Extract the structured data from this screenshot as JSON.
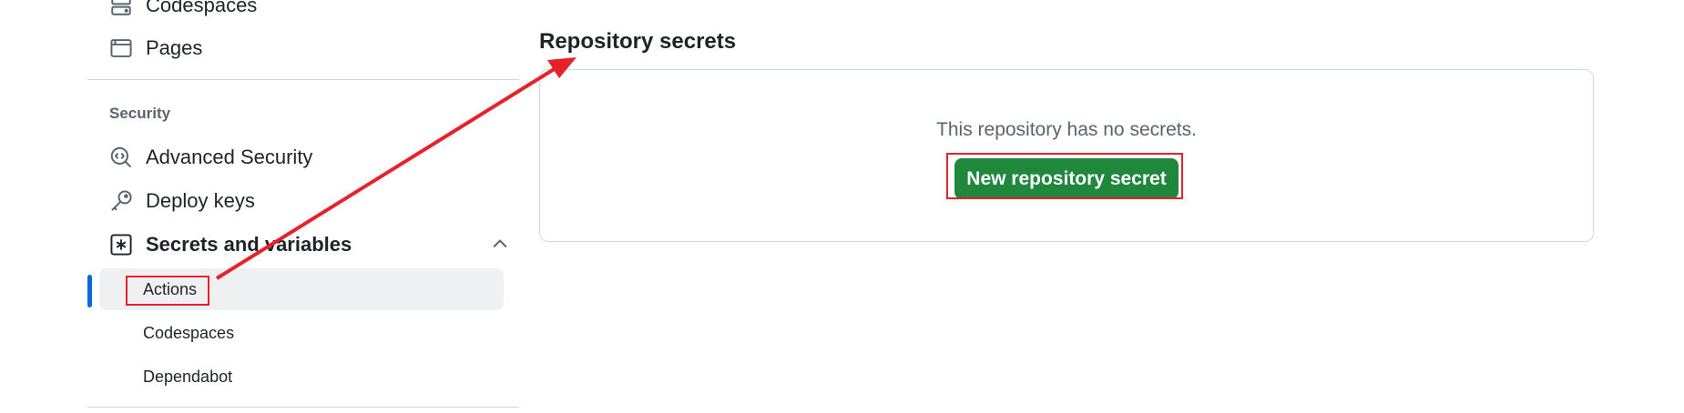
{
  "sidebar": {
    "items_top": [
      {
        "label": "Codespaces",
        "icon": "server-icon"
      },
      {
        "label": "Pages",
        "icon": "browser-icon"
      }
    ],
    "security_heading": "Security",
    "security_items": [
      {
        "label": "Advanced Security",
        "icon": "codescan-icon"
      },
      {
        "label": "Deploy keys",
        "icon": "key-icon"
      },
      {
        "label": "Secrets and variables",
        "icon": "asterisk-icon"
      }
    ],
    "sub_items": [
      {
        "label": "Actions",
        "active": true
      },
      {
        "label": "Codespaces",
        "active": false
      },
      {
        "label": "Dependabot",
        "active": false
      }
    ]
  },
  "main": {
    "title": "Repository secrets",
    "empty_text": "This repository has no secrets.",
    "new_secret_label": "New repository secret"
  },
  "colors": {
    "accent_blue": "#0969da",
    "primary_green": "#1f883d",
    "annotation_red": "#e5222a"
  }
}
